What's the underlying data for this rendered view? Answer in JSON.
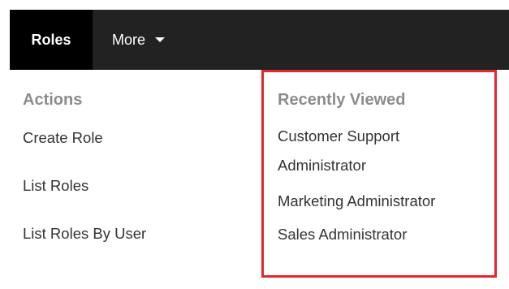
{
  "navbar": {
    "tabs": [
      {
        "label": "Roles",
        "active": true
      },
      {
        "label": "More",
        "active": false
      }
    ]
  },
  "actions": {
    "title": "Actions",
    "items": [
      {
        "label": "Create Role"
      },
      {
        "label": "List Roles"
      },
      {
        "label": "List Roles By User"
      }
    ]
  },
  "recently_viewed": {
    "title": "Recently Viewed",
    "items": [
      {
        "label": "Customer Support Administrator"
      },
      {
        "label": "Marketing Administrator"
      },
      {
        "label": "Sales Administrator"
      }
    ]
  },
  "colors": {
    "navbar_bg": "#222222",
    "active_tab_bg": "#000000",
    "highlight_border": "#e3282c",
    "section_title": "#8c8c8c",
    "menu_text": "#333333"
  },
  "icons": {
    "more_dropdown": "caret-down-icon"
  }
}
